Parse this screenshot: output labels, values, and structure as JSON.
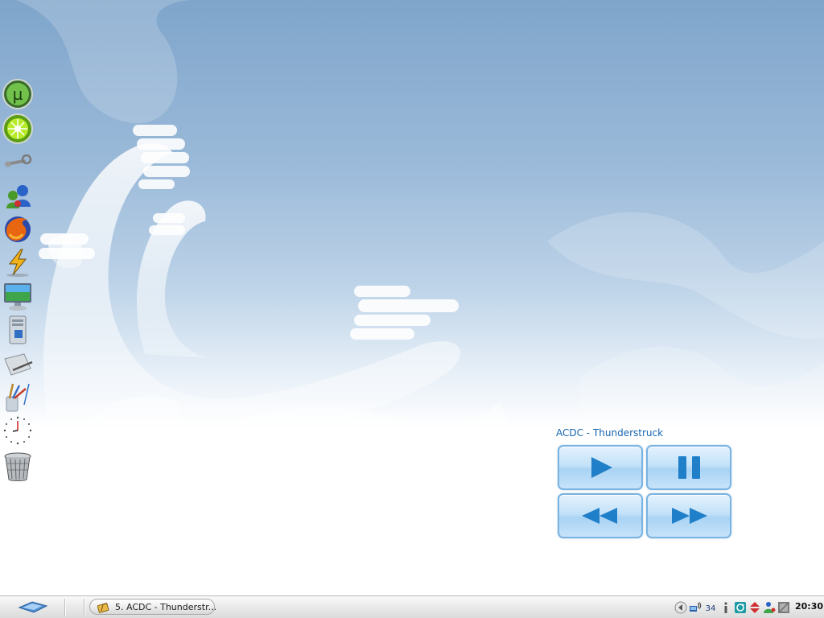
{
  "player": {
    "track_title": "ACDC - Thunderstruck",
    "buttons": [
      "play",
      "pause",
      "previous",
      "next"
    ]
  },
  "dock": {
    "items": [
      {
        "icon": "utorrent-icon"
      },
      {
        "icon": "limewire-icon"
      },
      {
        "icon": "steam-icon"
      },
      {
        "icon": "messenger-icon"
      },
      {
        "icon": "firefox-icon"
      },
      {
        "icon": "winamp-icon"
      },
      {
        "icon": "my-computer-icon"
      },
      {
        "icon": "system-tower-icon"
      },
      {
        "icon": "pen-tablet-icon"
      },
      {
        "icon": "paint-brushes-icon"
      },
      {
        "icon": "clock-icon"
      },
      {
        "icon": "recycle-bin-icon"
      }
    ]
  },
  "taskbar": {
    "task_label": "5. ACDC - Thunderstr...",
    "tray_icons": [
      "back-arrow-icon",
      "network-icon",
      "language-indicator-icon",
      "info-icon",
      "refresh-icon",
      "up-down-arrows-icon",
      "user-icon",
      "window-icon"
    ],
    "language": "34",
    "clock": "20:30"
  },
  "colors": {
    "title_blue": "#1565b3",
    "button_border": "#79b3e2",
    "icon_blue": "#1f7fc8"
  }
}
